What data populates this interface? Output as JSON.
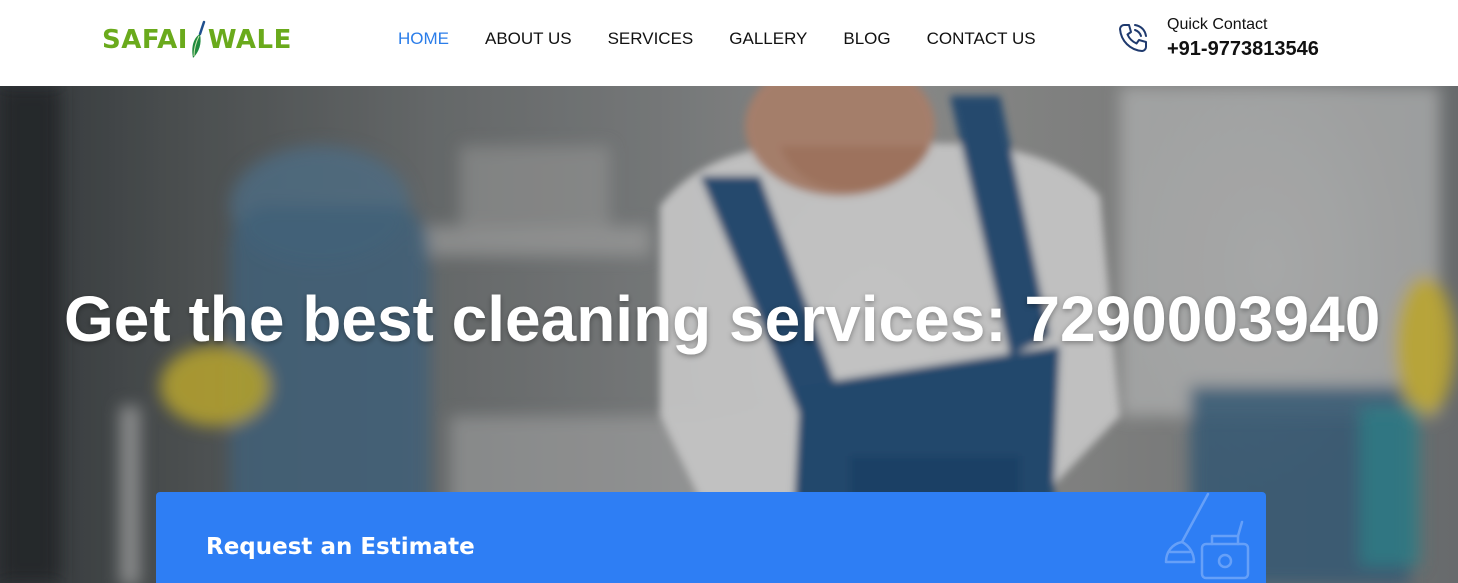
{
  "header": {
    "logo": {
      "left": "SAFAI",
      "right": "WALE"
    },
    "nav": [
      {
        "label": "HOME",
        "active": true
      },
      {
        "label": "ABOUT US",
        "active": false
      },
      {
        "label": "SERVICES",
        "active": false
      },
      {
        "label": "GALLERY",
        "active": false
      },
      {
        "label": "BLOG",
        "active": false
      },
      {
        "label": "CONTACT US",
        "active": false
      }
    ],
    "contact": {
      "icon": "phone-icon",
      "label": "Quick Contact",
      "number": "+91-9773813546"
    }
  },
  "hero": {
    "headline": "Get the best cleaning services: 7290003940"
  },
  "estimate": {
    "title": "Request an Estimate",
    "icon": "cleaning-tools-icon"
  },
  "colors": {
    "brand_green": "#6aaa1c",
    "accent_blue": "#2b7de9",
    "panel_blue": "#2e7ef4",
    "icon_navy": "#1f3a6e"
  }
}
